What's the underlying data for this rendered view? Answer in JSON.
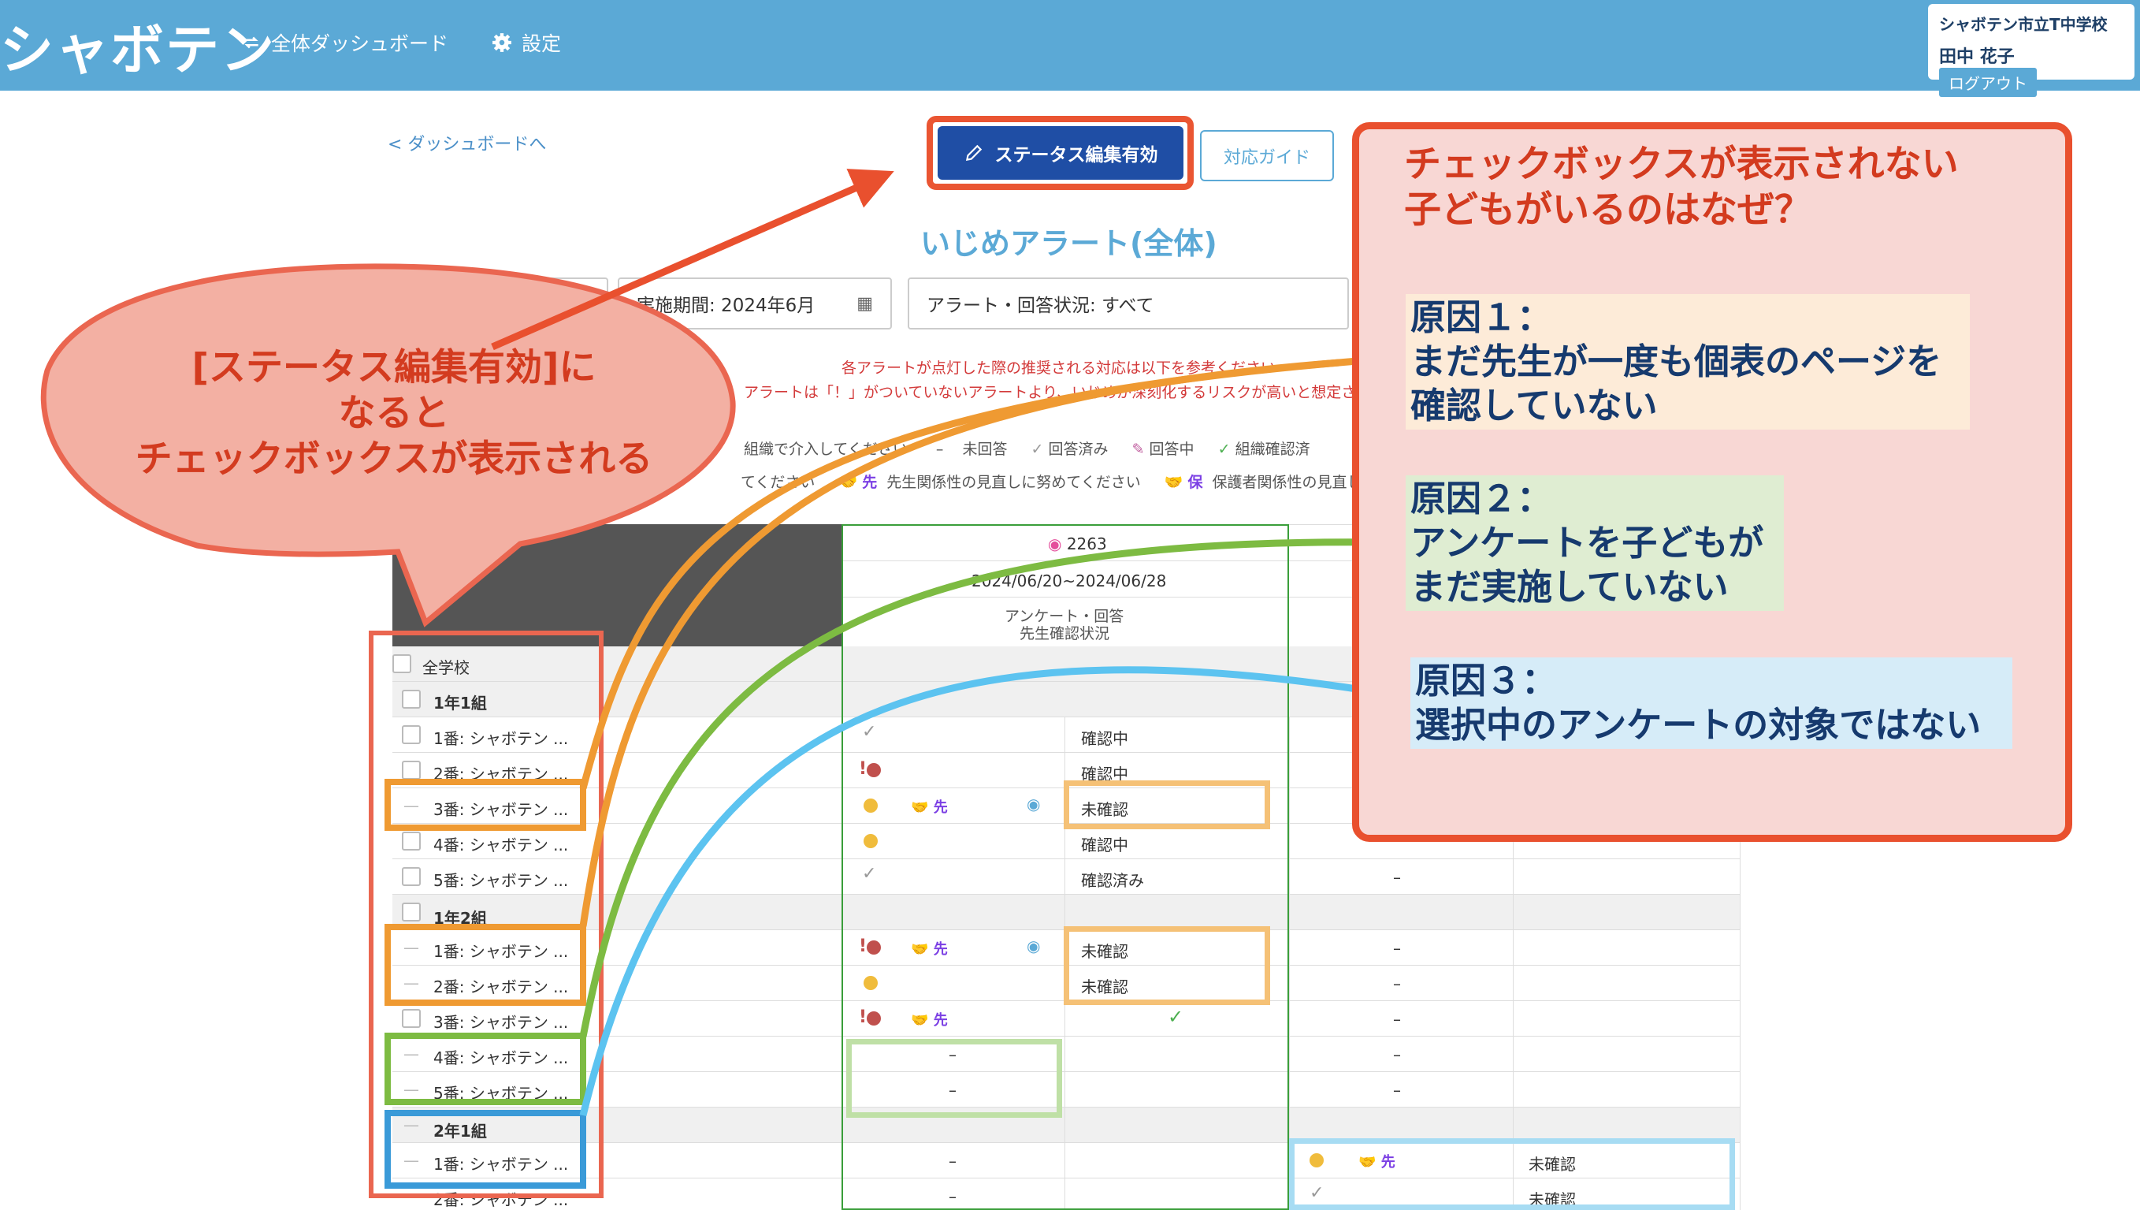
{
  "header": {
    "logo": "シャボテン",
    "nav": [
      {
        "label": "全体ダッシュボード",
        "icon": "refresh-icon"
      },
      {
        "label": "設定",
        "icon": "gear-icon"
      }
    ],
    "school": "シャボテン市立T中学校",
    "user": "田中 花子",
    "logout": "ログアウト"
  },
  "toolbar": {
    "back": "< ダッシュボードへ",
    "status_button": "ステータス編集有効",
    "guide_button": "対応ガイド",
    "title": "いじめアラート(全体)"
  },
  "filters": {
    "period": "実施期間: 2024年6月",
    "status": "アラート・回答状況: すべて"
  },
  "notes": [
    "各アラートが点灯した際の推奨される対応は以下を参考ください",
    "アラートは「！」がついていないアラートより、いじめが深刻化するリスクが高いと想定さ"
  ],
  "legend": {
    "line1": [
      "組織で介入してください",
      "未回答",
      "回答済み",
      "回答中",
      "組織確認済"
    ],
    "line2": [
      "てください",
      "先",
      "先生関係性の見直しに努めてください",
      "保",
      "保護者関係性の見直し"
    ],
    "dash": "–"
  },
  "survey": {
    "id": "2263",
    "period": "2024/06/20~2024/06/28",
    "col_label_1": "アンケート・回答",
    "col_label_2": "先生確認状況"
  },
  "rows": {
    "all": "全学校",
    "class_1_1": "1年1組",
    "s1": "1番: シャボテン ...",
    "s2": "2番: シャボテン ...",
    "s3": "3番: シャボテン ...",
    "s4": "4番: シャボテン ...",
    "s5": "5番: シャボテン ...",
    "class_1_2": "1年2組",
    "class_2_1": "2年1組",
    "status_checking": "確認中",
    "status_unconfirmed": "未確認",
    "status_confirmed": "確認済み",
    "tag_teacher": "先",
    "dash": "–"
  },
  "annotations": {
    "bubble": [
      "[ステータス編集有効]に",
      "なると",
      "チェックボックスが表示される"
    ],
    "callout_title": [
      "チェックボックスが表示されない",
      "子どもがいるのはなぜ？"
    ],
    "reason1": [
      "原因１：",
      "まだ先生が一度も個表のページを",
      "確認していない"
    ],
    "reason2": [
      "原因２：",
      "アンケートを子どもが",
      "まだ実施していない"
    ],
    "reason3": [
      "原因３：",
      "選択中のアンケートの対象ではない"
    ],
    "colors": {
      "red": "#e9502e",
      "orange": "#ef9a32",
      "green": "#7dbb42",
      "blue": "#5cc3f0"
    }
  }
}
